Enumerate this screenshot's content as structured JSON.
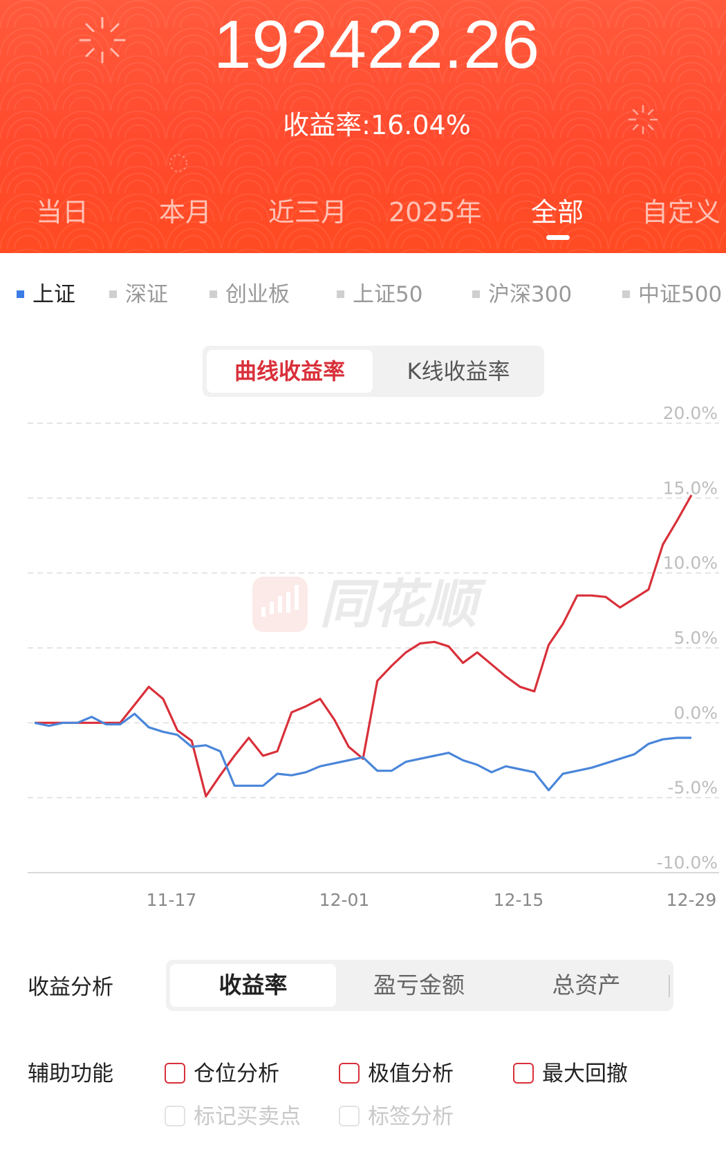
{
  "header": {
    "total_value": "192422.26",
    "rate_text": "收益率:16.04%",
    "tabs": [
      "当日",
      "本月",
      "近三月",
      "2025年",
      "全部",
      "自定义"
    ],
    "active_tab": "全部",
    "bg_color": "#ff4a2e"
  },
  "indexes": {
    "items": [
      "上证",
      "深证",
      "创业板",
      "上证50",
      "沪深300",
      "中证500"
    ],
    "active": "上证",
    "active_color": "#3b7be5"
  },
  "chart_mode": {
    "active": "曲线收益率",
    "other": "K线收益率"
  },
  "watermark": "同花顺",
  "chart_data": {
    "type": "line",
    "ylim": [
      -10,
      20
    ],
    "y_ticks": [
      "20.0%",
      "15.0%",
      "10.0%",
      "5.0%",
      "0.0%",
      "-5.0%",
      "-10.0%"
    ],
    "x_ticks": [
      "11-17",
      "12-01",
      "12-15",
      "12-29"
    ],
    "grid": true,
    "series": [
      {
        "color": "#d9303a",
        "points": [
          [
            0,
            0
          ],
          [
            1,
            0
          ],
          [
            2,
            0
          ],
          [
            3,
            0
          ],
          [
            4,
            0
          ],
          [
            5,
            0
          ],
          [
            6,
            0
          ],
          [
            7,
            1.2
          ],
          [
            8,
            2.4
          ],
          [
            9,
            1.6
          ],
          [
            10,
            -0.5
          ],
          [
            11,
            -1.2
          ],
          [
            12,
            -4.9
          ],
          [
            13,
            -3.5
          ],
          [
            14,
            -2.2
          ],
          [
            15,
            -1
          ],
          [
            16,
            -2.2
          ],
          [
            17,
            -1.9
          ],
          [
            18,
            0.7
          ],
          [
            19,
            1.1
          ],
          [
            20,
            1.6
          ],
          [
            21,
            0.2
          ],
          [
            22,
            -1.6
          ],
          [
            23,
            -2.4
          ],
          [
            24,
            2.8
          ],
          [
            25,
            3.8
          ],
          [
            26,
            4.7
          ],
          [
            27,
            5.3
          ],
          [
            28,
            5.4
          ],
          [
            29,
            5.1
          ],
          [
            30,
            4.0
          ],
          [
            31,
            4.7
          ],
          [
            32,
            3.9
          ],
          [
            33,
            3.1
          ],
          [
            34,
            2.4
          ],
          [
            35,
            2.1
          ],
          [
            36,
            5.2
          ],
          [
            37,
            6.6
          ],
          [
            38,
            8.5
          ],
          [
            39,
            8.5
          ],
          [
            40,
            8.4
          ],
          [
            41,
            7.7
          ],
          [
            42,
            8.3
          ],
          [
            43,
            8.9
          ],
          [
            44,
            11.9
          ],
          [
            45,
            13.5
          ],
          [
            46,
            15.2
          ]
        ]
      },
      {
        "color": "#4a86d9",
        "points": [
          [
            0,
            0
          ],
          [
            1,
            -0.2
          ],
          [
            2,
            0
          ],
          [
            3,
            0
          ],
          [
            4,
            0.4
          ],
          [
            5,
            -0.1
          ],
          [
            6,
            -0.1
          ],
          [
            7,
            0.6
          ],
          [
            8,
            -0.3
          ],
          [
            9,
            -0.6
          ],
          [
            10,
            -0.8
          ],
          [
            11,
            -1.6
          ],
          [
            12,
            -1.5
          ],
          [
            13,
            -1.9
          ],
          [
            14,
            -4.2
          ],
          [
            15,
            -4.2
          ],
          [
            16,
            -4.2
          ],
          [
            17,
            -3.4
          ],
          [
            18,
            -3.5
          ],
          [
            19,
            -3.3
          ],
          [
            20,
            -2.9
          ],
          [
            21,
            -2.7
          ],
          [
            22,
            -2.5
          ],
          [
            23,
            -2.3
          ],
          [
            24,
            -3.2
          ],
          [
            25,
            -3.2
          ],
          [
            26,
            -2.6
          ],
          [
            27,
            -2.4
          ],
          [
            28,
            -2.2
          ],
          [
            29,
            -2.0
          ],
          [
            30,
            -2.5
          ],
          [
            31,
            -2.8
          ],
          [
            32,
            -3.3
          ],
          [
            33,
            -2.9
          ],
          [
            34,
            -3.1
          ],
          [
            35,
            -3.3
          ],
          [
            36,
            -4.5
          ],
          [
            37,
            -3.4
          ],
          [
            38,
            -3.2
          ],
          [
            39,
            -3.0
          ],
          [
            40,
            -2.7
          ],
          [
            41,
            -2.4
          ],
          [
            42,
            -2.1
          ],
          [
            43,
            -1.4
          ],
          [
            44,
            -1.1
          ],
          [
            45,
            -1.0
          ],
          [
            46,
            -1.0
          ]
        ]
      }
    ]
  },
  "analysis": {
    "label": "收益分析",
    "options": [
      "收益率",
      "盈亏金额",
      "总资产"
    ],
    "active": "收益率"
  },
  "aux": {
    "label": "辅助功能",
    "items": [
      "仓位分析",
      "极值分析",
      "最大回撤"
    ],
    "disabled_items": [
      "标记买卖点",
      "标签分析"
    ]
  }
}
